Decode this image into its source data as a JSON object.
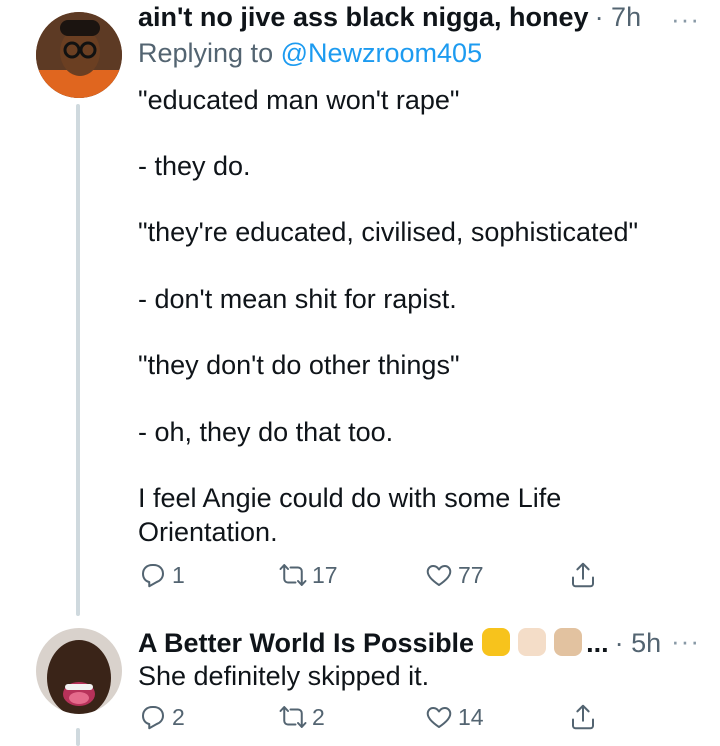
{
  "tweet1": {
    "name": "ain't no jive ass black nigga, honey",
    "time": "· 7h",
    "more": "···",
    "reply_prefix": "Replying to ",
    "reply_handle": "@Newzroom405",
    "lines": [
      "\"educated man won't rape\"",
      "- they do.",
      "\"they're educated, civilised, sophisticated\"",
      "- don't mean shit for rapist.",
      "\"they don't do other things\"",
      "- oh, they do that too.",
      "I feel Angie could do with some Life",
      "Orientation."
    ],
    "replies": "1",
    "retweets": "17",
    "likes": "77"
  },
  "tweet2": {
    "name": "A Better World Is Possible",
    "ellipsis": "...",
    "time": "· 5h",
    "more": "···",
    "text": "She definitely skipped it.",
    "replies": "2",
    "retweets": "2",
    "likes": "14",
    "emoji_colors": [
      "#f7c31c",
      "#f4ddc8",
      "#e2c2a0"
    ]
  },
  "icons": [
    "reply-icon",
    "retweet-icon",
    "like-icon",
    "share-icon",
    "more-icon"
  ]
}
